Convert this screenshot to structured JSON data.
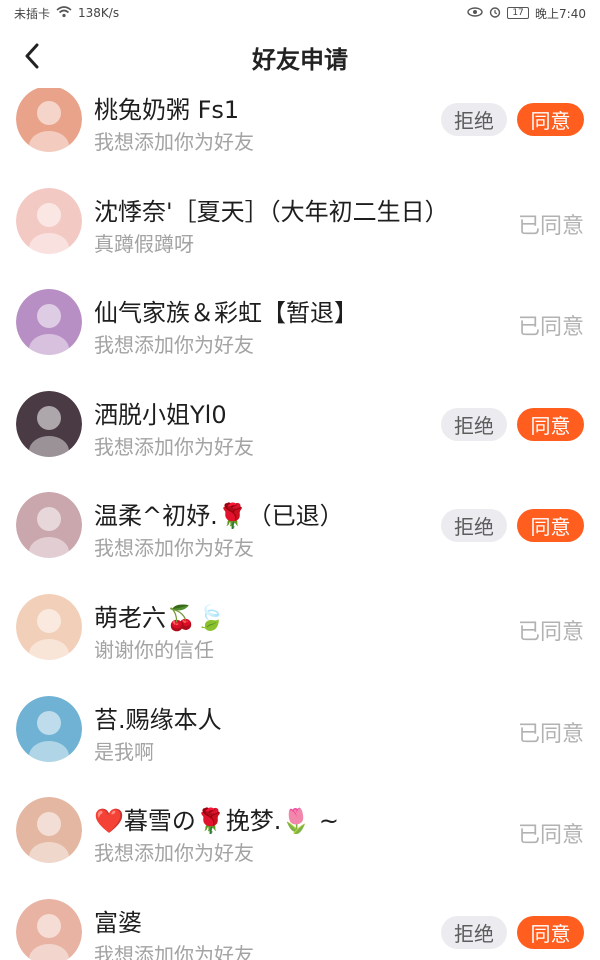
{
  "status_bar": {
    "carrier": "未插卡",
    "network_speed": "138K/s",
    "battery": "17",
    "time": "晚上7:40"
  },
  "header": {
    "title": "好友申请"
  },
  "labels": {
    "reject": "拒绝",
    "agree": "同意",
    "agreed": "已同意"
  },
  "requests": [
    {
      "name": "桃兔奶粥 Fs1",
      "message": "我想添加你为好友",
      "status": "pending",
      "avatar_color": "#e9a38a"
    },
    {
      "name": "沈悸奈'［夏天］（大年初二生日）",
      "message": "真蹲假蹲呀",
      "status": "agreed",
      "avatar_color": "#f3c9c4"
    },
    {
      "name": "仙气家族＆彩虹【暂退】",
      "message": "我想添加你为好友",
      "status": "agreed",
      "avatar_color": "#b78fc4"
    },
    {
      "name": "洒脱小姐Yl0",
      "message": "我想添加你为好友",
      "status": "pending",
      "avatar_color": "#4a3a44"
    },
    {
      "name": "温柔^初妤.🌹（已退）",
      "message": "我想添加你为好友",
      "status": "pending",
      "avatar_color": "#caa6ad"
    },
    {
      "name": "萌老六🍒🍃",
      "message": "谢谢你的信任",
      "status": "agreed",
      "avatar_color": "#f2cfb8"
    },
    {
      "name": "苔.赐缘本人",
      "message": "是我啊",
      "status": "agreed",
      "avatar_color": "#6fb2d3"
    },
    {
      "name": "❤️暮雪の🌹挽梦.🌷 ~",
      "message": "我想添加你为好友",
      "status": "agreed",
      "avatar_color": "#e4b7a2"
    },
    {
      "name": "富婆",
      "message": "我想添加你为好友",
      "status": "pending",
      "avatar_color": "#e8b3a3"
    }
  ]
}
